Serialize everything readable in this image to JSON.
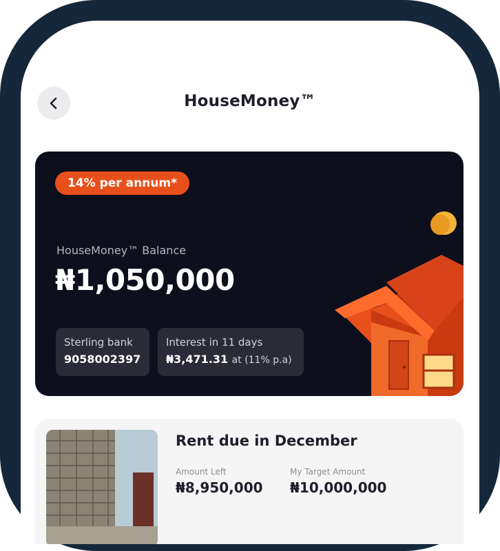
{
  "header": {
    "title": "HouseMoney™",
    "back_icon": "chevron-left-icon"
  },
  "balance_card": {
    "rate_badge": "14% per annum*",
    "balance_label": "HouseMoney™ Balance",
    "balance_amount": "₦1,050,000",
    "bank": {
      "label": "Sterling bank",
      "value": "9058002397"
    },
    "interest": {
      "label": "Interest in 11 days",
      "value": "₦3,471.31",
      "suffix": "at (11% p.a)"
    },
    "colors": {
      "card_bg": "#0d0f1c",
      "accent": "#e8501b",
      "coin": "#f6b43a"
    }
  },
  "rent_card": {
    "title": "Rent due in December",
    "amount_left": {
      "label": "Amount Left",
      "value": "₦8,950,000"
    },
    "target_amount": {
      "label": "My Target Amount",
      "value": "₦10,000,000"
    }
  }
}
